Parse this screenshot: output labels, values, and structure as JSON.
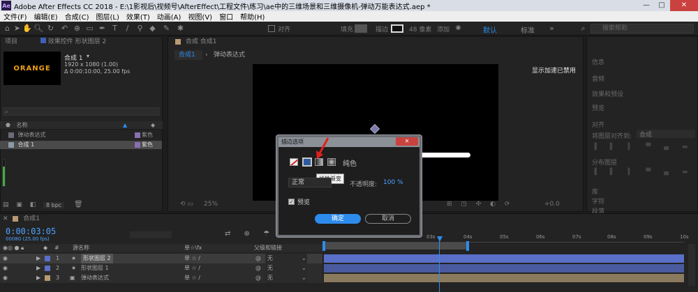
{
  "window": {
    "app_title": "Adobe After Effects CC 2018 - E:\\1影视后\\视频号\\AfterEffect\\工程文件\\练习\\ae中的三维场景和三维摄像机-弹动万能表达式.aep *",
    "logo": "Ae"
  },
  "menu": [
    "文件(F)",
    "编辑(E)",
    "合成(C)",
    "图层(L)",
    "效果(T)",
    "动画(A)",
    "视图(V)",
    "窗口",
    "帮助(H)"
  ],
  "toolbar": {
    "align_label": "对齐",
    "fill_label": "填充",
    "stroke_label": "描边",
    "stroke_px": "48 像素",
    "add_label": "添加",
    "workspace_active": "默认",
    "workspace_other": "标准",
    "search_placeholder": "搜索帮助"
  },
  "project_panel": {
    "tab_project": "项目",
    "tab_effects": "效果控件 形状图层 2",
    "thumb_text": "ORANGE",
    "comp_name": "合成 1",
    "comp_dims": "1920 x 1080 (1.00)",
    "comp_duration": "Δ 0:00:10:00, 25.00 fps",
    "col_name": "名称",
    "rows": [
      {
        "name": "弹动表达式",
        "tag": "紫色"
      },
      {
        "name": "合成 1",
        "tag": "紫色"
      }
    ],
    "bpc": "8 bpc"
  },
  "viewer": {
    "tab": "合成 合成1",
    "crumb_comp": "合成1",
    "crumb_expr": "弹动表达式",
    "notice": "显示加速已禁用",
    "zoom": "25%",
    "time_offset": "+0.0"
  },
  "right_panel": {
    "items": [
      "信息",
      "音频",
      "效果和预设",
      "预览",
      "对齐",
      "将图层对齐到:",
      "合成",
      "分布图层",
      "库",
      "字符",
      "段落"
    ]
  },
  "dialog": {
    "title": "描边选项",
    "close": "✕",
    "fill_type": "纯色",
    "tooltip": "线性渐变",
    "blend_mode": "正常",
    "opacity_label": "不透明度:",
    "opacity_value": "100 %",
    "preview_label": "预览",
    "ok": "确定",
    "cancel": "取消"
  },
  "timeline": {
    "tab": "合成1",
    "timecode": "0:00:03:05",
    "frame_info": "00080 (25.00 fps)",
    "col_source": "源名称",
    "col_switches": "单☆\\fx",
    "col_parent": "父级和链接",
    "ruler": [
      "03s",
      "04s",
      "05s",
      "06s",
      "07s",
      "08s",
      "09s",
      "10s"
    ],
    "layers": [
      {
        "num": "1",
        "name": "形状图层 2",
        "parent": "无",
        "color": "#5a6fc8"
      },
      {
        "num": "2",
        "name": "形状图层 1",
        "parent": "无",
        "color": "#5a6fc8"
      },
      {
        "num": "3",
        "name": "弹动表达式",
        "parent": "无",
        "color": "#b89a72"
      }
    ]
  },
  "colors": {
    "accent_blue": "#2d8ceb",
    "timecode_blue": "#4da3ff",
    "orange_text": "#f0a017",
    "close_red": "#c9423f",
    "arrow_red": "#e0201c"
  }
}
